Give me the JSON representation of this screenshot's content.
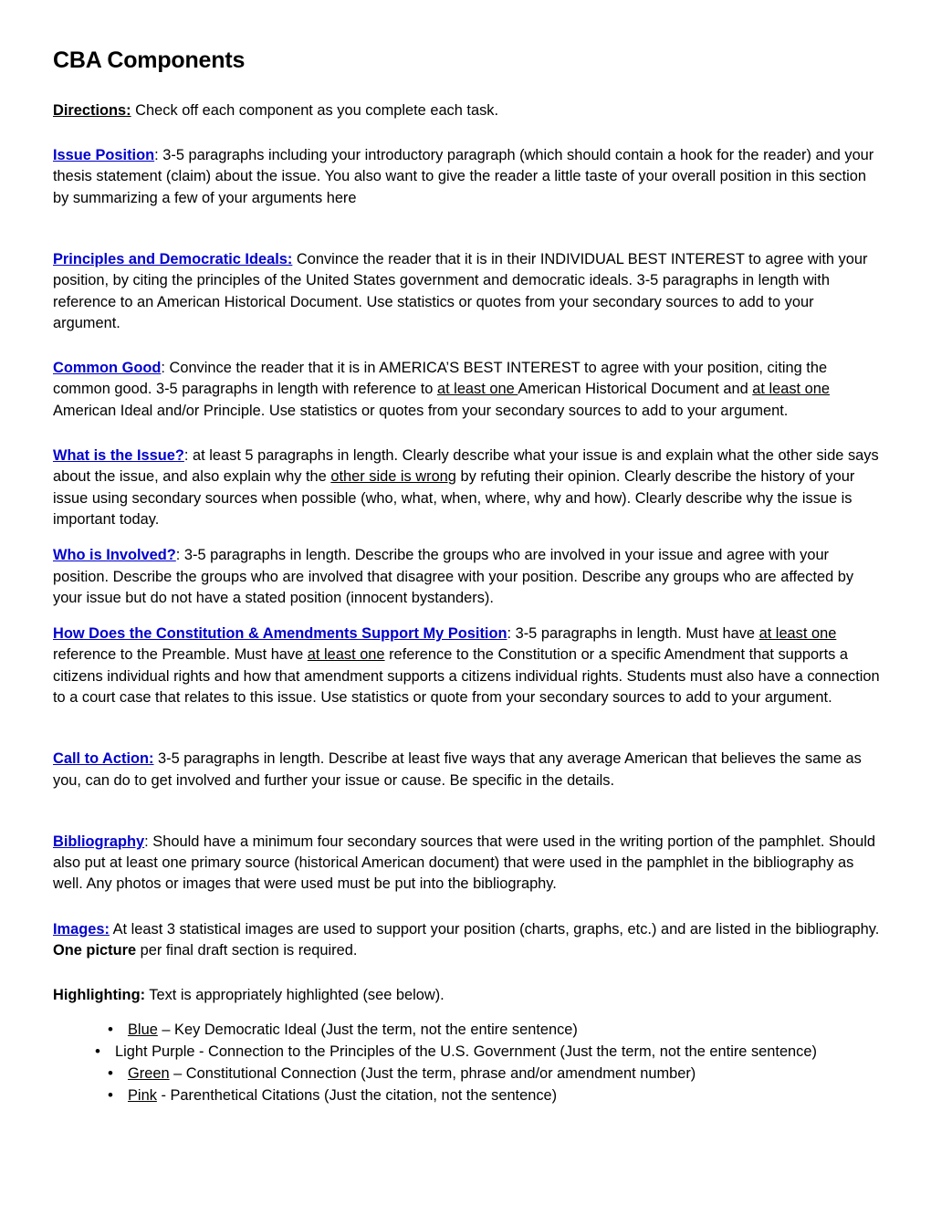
{
  "document": {
    "title": "CBA Components",
    "sections": [
      {
        "key": "directions",
        "label": "Directions:",
        "label_style": "black-underline-bold",
        "body": " Check off each component as you complete each task."
      },
      {
        "key": "issue_position",
        "label": "Issue Position",
        "label_style": "blue-underline-bold",
        "label_suffix": ":",
        "body": "  3-5 paragraphs including your introductory paragraph (which should contain a hook for the reader) and your thesis statement (claim) about the issue.  You also want to give the reader a little taste of your overall position in this section by summarizing a few of your arguments here"
      },
      {
        "key": "principles_and_democratic_ideals",
        "label": "Principles and Democratic Ideals:",
        "label_style": "blue-underline-bold",
        "label_suffix": "",
        "body_part_1": "  Convince the reader that it is in their INDIVIDUAL BEST INTEREST to agree with your position, by citing the principles of the United States government and democratic ideals.  3-5 paragraphs in length with reference to an American Historical Document.  Use statistics or quotes from your secondary sources to add to your argument."
      },
      {
        "key": "common_good",
        "label": "Common Good",
        "label_style": "blue-underline-bold",
        "label_suffix": ":",
        "body_part_1": "  Convince the reader that it is in AMERICA’S BEST INTEREST to agree with your position, citing the common good.  3-5 paragraphs in length with reference to ",
        "underlined_1": "at least one ",
        "body_part_2": "American Historical Document and ",
        "underlined_2": "at least one",
        "body_part_3": " American Ideal and/or Principle.  Use statistics or quotes from your secondary sources to add to your argument."
      },
      {
        "key": "what_is_the_issue",
        "label": "What is the Issue?",
        "label_style": "blue-underline-bold",
        "label_suffix": ":",
        "body_part_1": "  at least 5 paragraphs in length.  Clearly describe what your issue is and explain what the other side says about the issue, and also explain why the ",
        "underlined_1": "other side is wrong",
        "body_part_2": " by refuting their opinion.  Clearly describe the history of your issue using secondary sources when possible (who, what, when, where, why and how).  Clearly describe why the issue is important today."
      },
      {
        "key": "who_is_involved",
        "label": "Who is Involved?",
        "label_style": "blue-underline-bold",
        "label_suffix": ":",
        "body_part_1": "  3-5 paragraphs in length. Describe the groups who are involved in your issue and agree with your position.  Describe the groups who are involved that disagree with your position.    Describe any groups who are affected by your issue but do not have a stated position (innocent bystanders)."
      },
      {
        "key": "constitution_support",
        "label": "How Does the Constitution & Amendments Support My Position",
        "label_style": "blue-underline-bold",
        "label_suffix": ":",
        "body_part_1": "  3-5 paragraphs in length.  Must have ",
        "underlined_1": "at least one",
        "body_part_2": " reference to the Preamble.  Must have ",
        "underlined_2": "at least one",
        "body_part_3": " reference to the Constitution or a specific Amendment that supports a citizens individual rights and how that amendment supports a citizens individual rights.  Students must also have a connection to a court case that relates to this issue.  Use statistics or quote from your secondary sources to add to your argument."
      },
      {
        "key": "call_to_action",
        "label": "Call to Action:",
        "label_style": "blue-underline-bold",
        "label_suffix": "",
        "body_part_1": "  3-5 paragraphs in length.  Describe at least five ways that any average American that believes the same as you, can do to get involved and further your issue or cause.  Be specific in the details."
      },
      {
        "key": "bibliography",
        "label": "Bibliography",
        "label_style": "blue-underline-bold",
        "label_suffix": ":",
        "body_part_1": "  Should have a minimum four secondary sources that were used in the writing portion of the pamphlet.  Should also put at least one primary source (historical American document) that were used in the pamphlet in the bibliography as well.  Any photos or images that were used must be put into the bibliography."
      },
      {
        "key": "images",
        "label": "Images:",
        "label_style": "blue-underline-bold",
        "label_suffix": "",
        "body_part_1": "  At least 3 statistical images are used to support your position (charts, graphs, etc.) and are listed in the bibliography.  ",
        "bold_1": "One picture",
        "body_part_2": " per final draft section is required."
      },
      {
        "key": "highlighting",
        "label": "Highlighting:",
        "label_style": "black-bold",
        "label_suffix": "",
        "body_part_1": "  Text is appropriately highlighted (see below)."
      }
    ],
    "legend": [
      {
        "color_name": "Blue",
        "underlined": true,
        "indented": true,
        "text": " – Key Democratic Ideal (Just the term, not the entire sentence)"
      },
      {
        "color_name": "Light Purple",
        "underlined": false,
        "indented": false,
        "text": " - Connection to the Principles of the U.S. Government  (Just the term, not the entire sentence)"
      },
      {
        "color_name": "Green",
        "underlined": true,
        "indented": false,
        "text": " – Constitutional Connection (Just the term, phrase and/or amendment number)"
      },
      {
        "color_name": "Pink",
        "underlined": true,
        "indented": false,
        "text": " - Parenthetical Citations (Just the citation, not the sentence)"
      }
    ]
  },
  "theme": {
    "heading_link_color": "#0000CC",
    "text_color": "#000000",
    "page_background": "#FFFFFF"
  }
}
